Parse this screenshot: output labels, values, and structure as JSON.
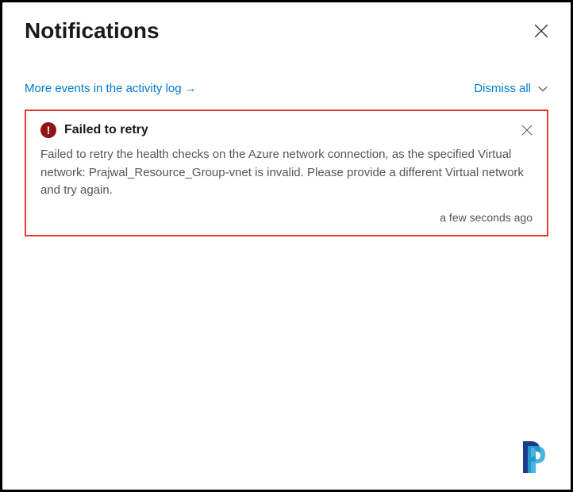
{
  "header": {
    "title": "Notifications"
  },
  "actions": {
    "activity_log_link": "More events in the activity log",
    "activity_log_arrow": "→",
    "dismiss_all": "Dismiss all"
  },
  "notification": {
    "icon_glyph": "!",
    "title": "Failed to retry",
    "message": "Failed to retry the health checks on the Azure network connection, as the specified Virtual network: Prajwal_Resource_Group-vnet is invalid. Please provide a different Virtual network and try again.",
    "timestamp": "a few seconds ago"
  }
}
